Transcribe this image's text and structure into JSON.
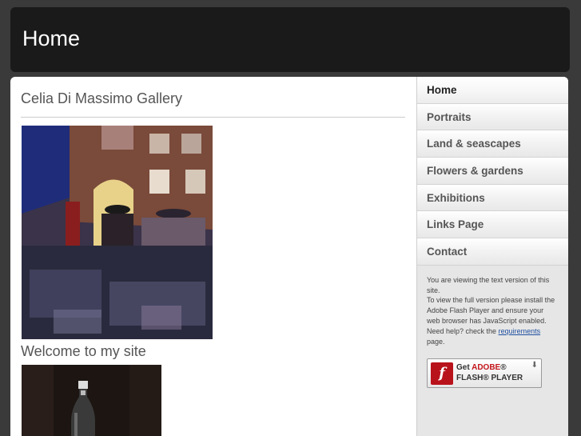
{
  "header": {
    "title": "Home"
  },
  "main": {
    "site_title": "Celia Di Massimo Gallery",
    "welcome": "Welcome to my site"
  },
  "sidebar": {
    "nav": [
      {
        "label": "Home",
        "active": true
      },
      {
        "label": "Portraits"
      },
      {
        "label": "Land & seascapes"
      },
      {
        "label": "Flowers & gardens"
      },
      {
        "label": "Exhibitions"
      },
      {
        "label": "Links Page"
      },
      {
        "label": "Contact"
      }
    ],
    "notice": {
      "line1": "You are viewing the text version of this site.",
      "line2": "To view the full version please install the Adobe Flash Player and ensure your web browser has JavaScript enabled.",
      "help_prefix": "Need help? check the",
      "help_link": "requirements",
      "help_suffix": "page."
    },
    "flash_badge": {
      "get": "Get",
      "adobe": "ADOBE",
      "registered": "®",
      "product": "FLASH® PLAYER",
      "logo_letter": "f"
    }
  }
}
